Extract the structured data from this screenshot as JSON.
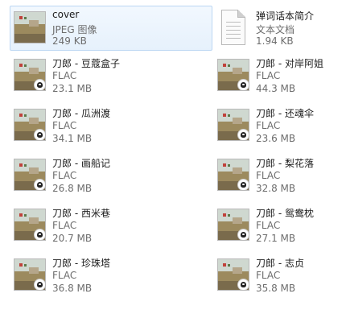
{
  "files": [
    {
      "name": "cover",
      "type": "JPEG 图像",
      "size": "249 KB",
      "icon": "image-thumbnail-icon"
    },
    {
      "name": "弹词话本简介",
      "type": "文本文档",
      "size": "1.94 KB",
      "icon": "text-document-icon"
    },
    {
      "name": "刀郎 - 豆蔻盒子",
      "type": "FLAC",
      "size": "23.1 MB",
      "icon": "audio-file-icon"
    },
    {
      "name": "刀郎 - 对岸阿姐",
      "type": "FLAC",
      "size": "44.3 MB",
      "icon": "audio-file-icon"
    },
    {
      "name": "刀郎 - 瓜洲渡",
      "type": "FLAC",
      "size": "34.1 MB",
      "icon": "audio-file-icon"
    },
    {
      "name": "刀郎 - 还魂伞",
      "type": "FLAC",
      "size": "23.6 MB",
      "icon": "audio-file-icon"
    },
    {
      "name": "刀郎 - 画船记",
      "type": "FLAC",
      "size": "26.8 MB",
      "icon": "audio-file-icon"
    },
    {
      "name": "刀郎 - 梨花落",
      "type": "FLAC",
      "size": "32.8 MB",
      "icon": "audio-file-icon"
    },
    {
      "name": "刀郎 - 西米巷",
      "type": "FLAC",
      "size": "20.7 MB",
      "icon": "audio-file-icon"
    },
    {
      "name": "刀郎 - 鸳鸯枕",
      "type": "FLAC",
      "size": "27.1 MB",
      "icon": "audio-file-icon"
    },
    {
      "name": "刀郎 - 珍珠塔",
      "type": "FLAC",
      "size": "36.8 MB",
      "icon": "audio-file-icon"
    },
    {
      "name": "刀郎 - 志贞",
      "type": "FLAC",
      "size": "35.8 MB",
      "icon": "audio-file-icon"
    }
  ],
  "colors": {
    "selection_bg": "#e6f1fc",
    "selection_border": "#bcd7f3",
    "secondary_text": "#6d6d6d"
  }
}
